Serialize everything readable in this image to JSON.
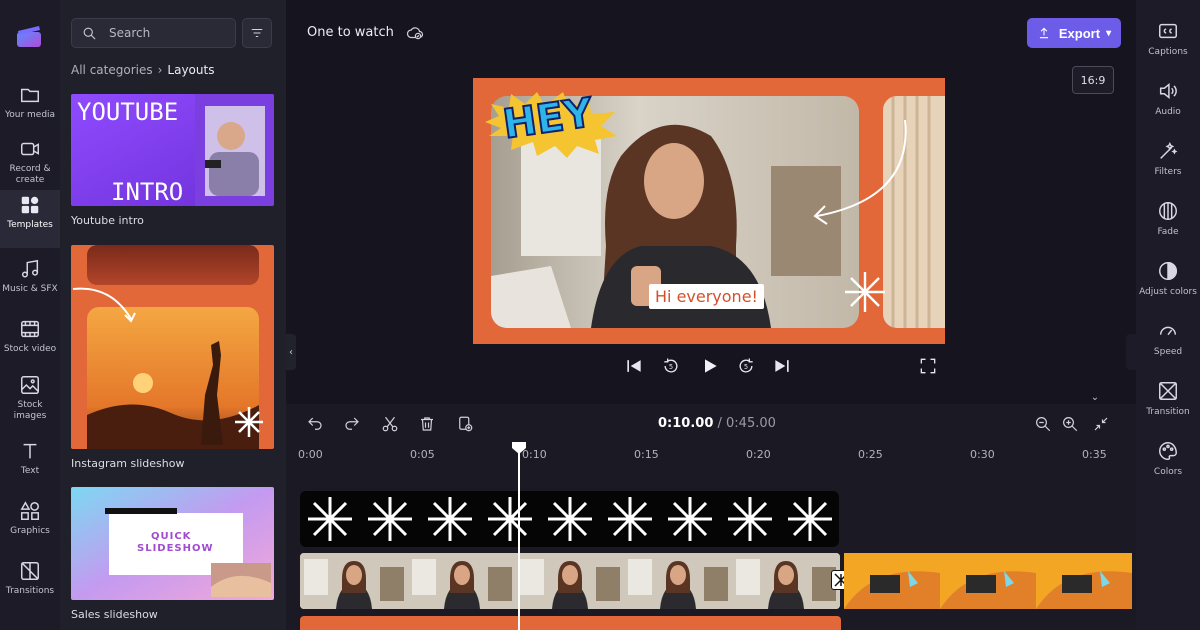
{
  "rail": {
    "items": [
      {
        "label": "Your media",
        "icon": "folder-icon"
      },
      {
        "label": "Record & create",
        "icon": "camera-icon"
      },
      {
        "label": "Templates",
        "icon": "templates-icon",
        "active": true
      },
      {
        "label": "Music & SFX",
        "icon": "music-icon"
      },
      {
        "label": "Stock video",
        "icon": "film-icon"
      },
      {
        "label": "Stock images",
        "icon": "image-icon"
      },
      {
        "label": "Text",
        "icon": "text-icon"
      },
      {
        "label": "Graphics",
        "icon": "shapes-icon"
      },
      {
        "label": "Transitions",
        "icon": "transition-icon"
      }
    ]
  },
  "panel": {
    "search_placeholder": "Search",
    "breadcrumb": {
      "parent": "All categories",
      "current": "Layouts"
    },
    "templates": [
      {
        "label": "Youtube intro",
        "thumb_title_top": "YOUTUBE",
        "thumb_title_bottom": "INTRO"
      },
      {
        "label": "Instagram slideshow"
      },
      {
        "label": "Sales slideshow",
        "thumb_text_1": "QUICK",
        "thumb_text_2": "SLIDESHOW"
      }
    ]
  },
  "topbar": {
    "project_title": "One to watch",
    "export_label": "Export",
    "aspect_ratio": "16:9"
  },
  "preview": {
    "sticker_text": "HEY",
    "caption_text": "Hi everyone!"
  },
  "right_rail": {
    "items": [
      {
        "label": "Captions",
        "icon": "captions-icon"
      },
      {
        "label": "Audio",
        "icon": "audio-icon"
      },
      {
        "label": "Filters",
        "icon": "filters-icon"
      },
      {
        "label": "Fade",
        "icon": "fade-icon"
      },
      {
        "label": "Adjust colors",
        "icon": "adjust-colors-icon"
      },
      {
        "label": "Speed",
        "icon": "speed-icon"
      },
      {
        "label": "Transition",
        "icon": "transition-icon"
      },
      {
        "label": "Colors",
        "icon": "palette-icon"
      }
    ]
  },
  "timeline": {
    "current_time": "0:10.00",
    "separator": " / ",
    "total_time": "0:45.00",
    "ruler_ticks": [
      "0:00",
      "0:05",
      "0:10",
      "0:15",
      "0:20",
      "0:25",
      "0:30",
      "0:35"
    ]
  },
  "colors": {
    "accent": "#6c5ce7",
    "brand_orange": "#e2683a",
    "background": "#16151f"
  }
}
